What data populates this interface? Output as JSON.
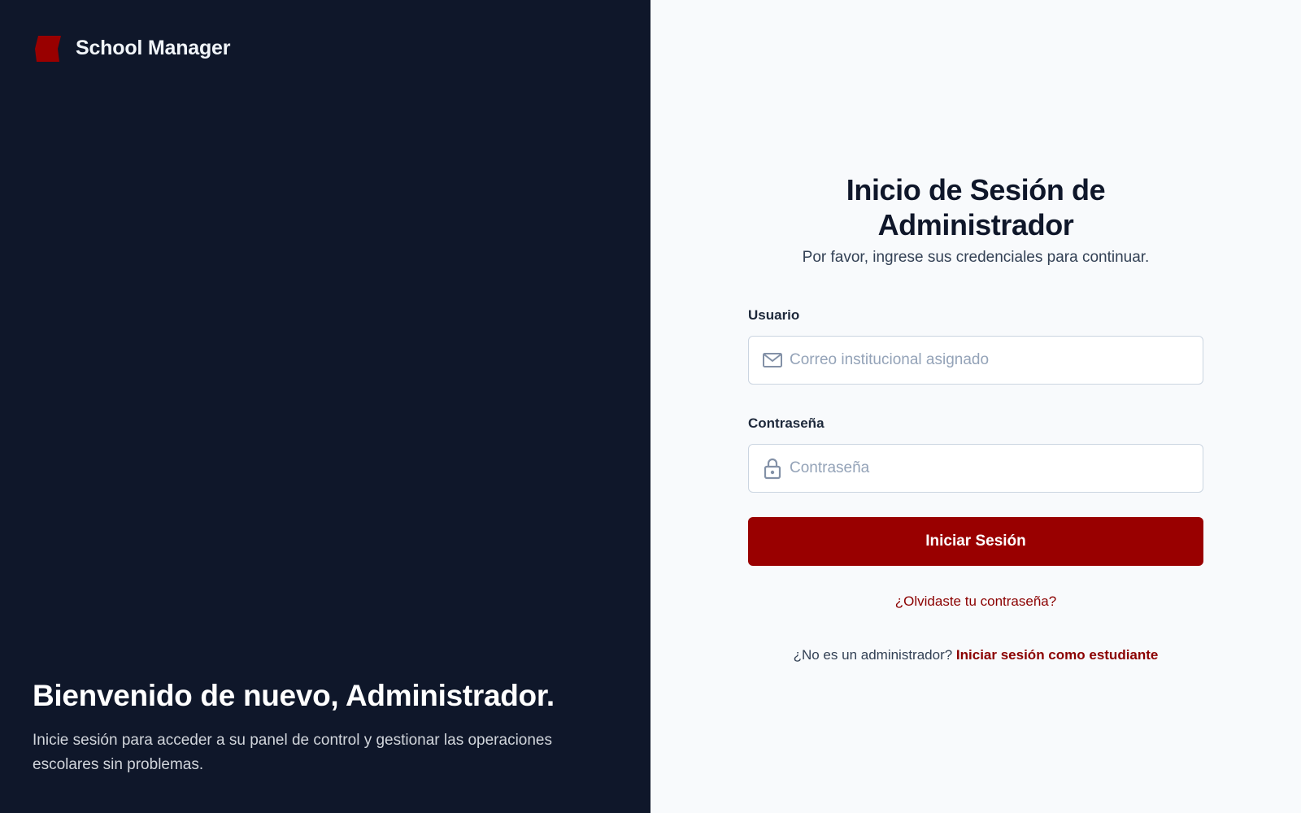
{
  "brand": {
    "name": "School Manager",
    "logo_icon": "school-logo-icon",
    "accent_color": "#990000"
  },
  "welcome": {
    "title": "Bienvenido de nuevo, Administrador.",
    "text": "Inicie sesión para acceder a su panel de control y gestionar las operaciones escolares sin problemas."
  },
  "login": {
    "title": "Inicio de Sesión de Administrador",
    "subtitle": "Por favor, ingrese sus credenciales para continuar.",
    "username": {
      "label": "Usuario",
      "placeholder": "Correo institucional asignado",
      "value": "",
      "icon": "mail-icon"
    },
    "password": {
      "label": "Contraseña",
      "placeholder": "Contraseña",
      "value": "",
      "icon": "lock-icon"
    },
    "submit_label": "Iniciar Sesión",
    "forgot_label": "¿Olvidaste tu contraseña?",
    "alt_prompt": "¿No es un administrador?",
    "alt_link_label": "Iniciar sesión como estudiante"
  },
  "colors": {
    "left_panel_bg": "#0f172a",
    "right_panel_bg": "#f8fafc",
    "primary_button": "#990000",
    "link": "#8b0000"
  }
}
